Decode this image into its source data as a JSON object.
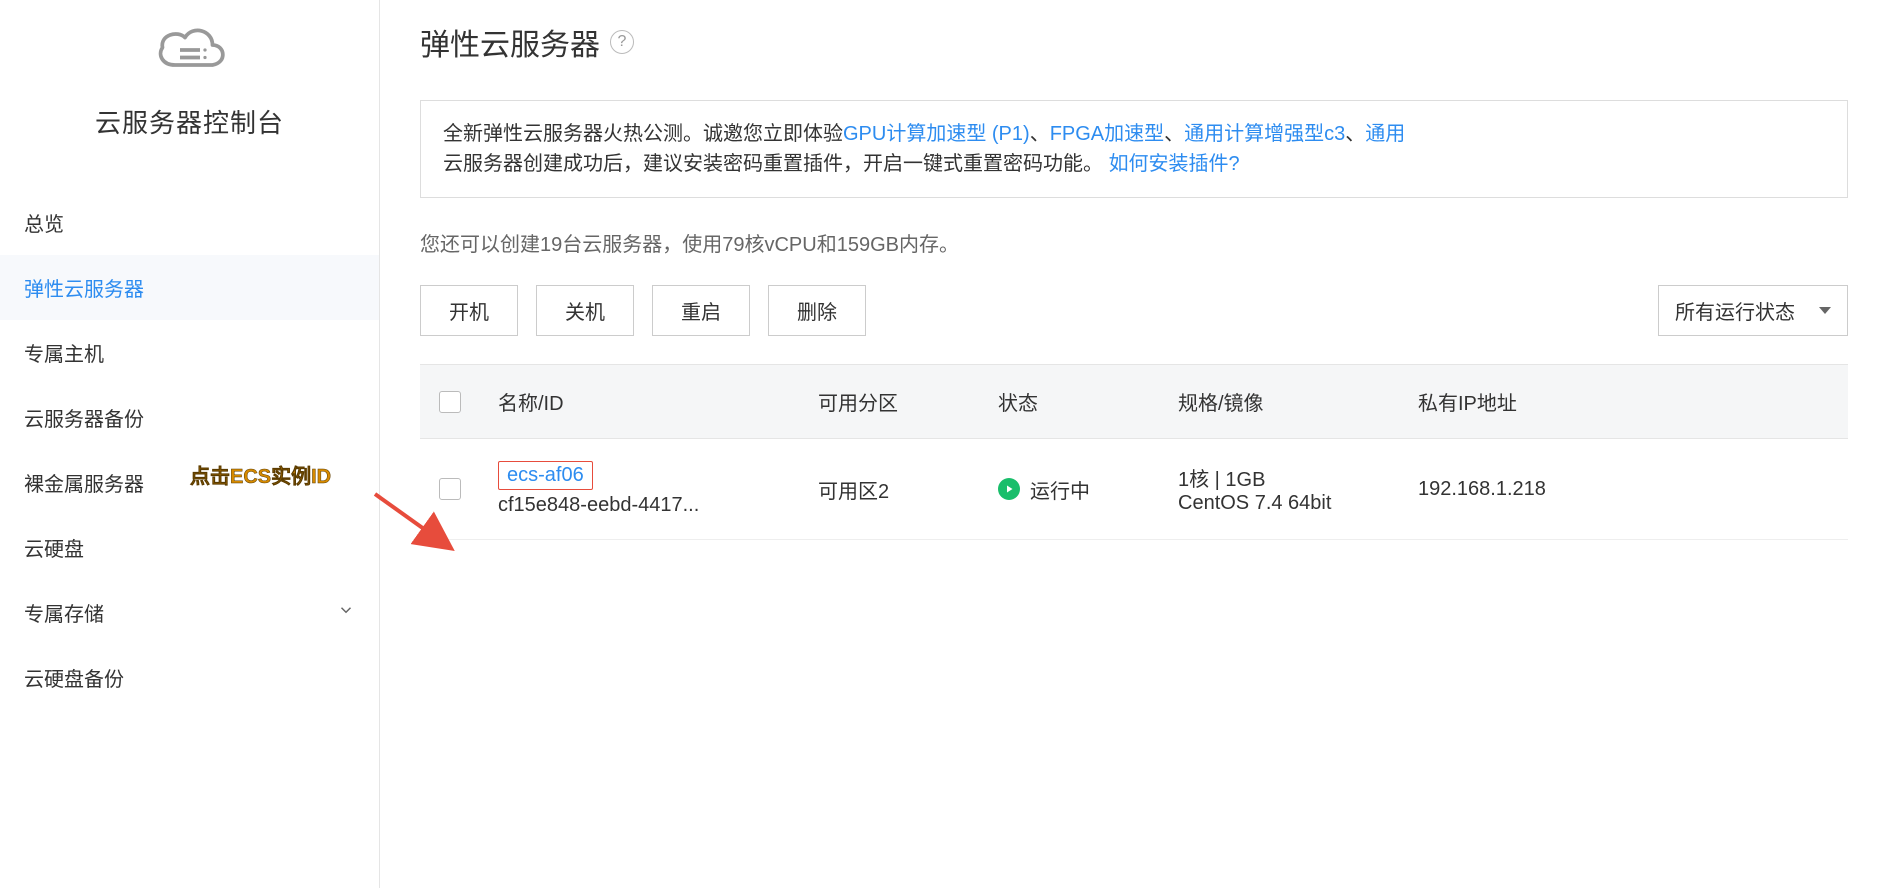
{
  "sidebar": {
    "title": "云服务器控制台",
    "items": [
      {
        "label": "总览",
        "active": false,
        "expandable": false
      },
      {
        "label": "弹性云服务器",
        "active": true,
        "expandable": false
      },
      {
        "label": "专属主机",
        "active": false,
        "expandable": false
      },
      {
        "label": "云服务器备份",
        "active": false,
        "expandable": false
      },
      {
        "label": "裸金属服务器",
        "active": false,
        "expandable": false
      },
      {
        "label": "云硬盘",
        "active": false,
        "expandable": false
      },
      {
        "label": "专属存储",
        "active": false,
        "expandable": true
      },
      {
        "label": "云硬盘备份",
        "active": false,
        "expandable": false
      }
    ]
  },
  "page": {
    "title": "弹性云服务器"
  },
  "notice": {
    "line1_prefix": "全新弹性云服务器火热公测。诚邀您立即体验",
    "link_gpu": "GPU计算加速型 (P1)",
    "sep1": "、",
    "link_fpga": "FPGA加速型",
    "sep2": "、",
    "link_c3": "通用计算增强型c3",
    "sep3": "、",
    "link_general_cut": "通用",
    "line2_prefix": "云服务器创建成功后，建议安装密码重置插件，开启一键式重置密码功能。",
    "link_install": "如何安装插件?"
  },
  "quota_line": "您还可以创建19台云服务器，使用79核vCPU和159GB内存。",
  "toolbar": {
    "start": "开机",
    "stop": "关机",
    "reboot": "重启",
    "delete": "删除",
    "filter_label": "所有运行状态"
  },
  "table": {
    "headers": {
      "name": "名称/ID",
      "zone": "可用分区",
      "status": "状态",
      "spec": "规格/镜像",
      "ip": "私有IP地址"
    },
    "rows": [
      {
        "name": "ecs-af06",
        "id": "cf15e848-eebd-4417...",
        "zone": "可用区2",
        "status": "运行中",
        "spec_line1": "1核 | 1GB",
        "spec_line2": "CentOS 7.4 64bit",
        "ip": "192.168.1.218"
      }
    ]
  },
  "annotation": {
    "text": "点击ECS实例ID"
  }
}
